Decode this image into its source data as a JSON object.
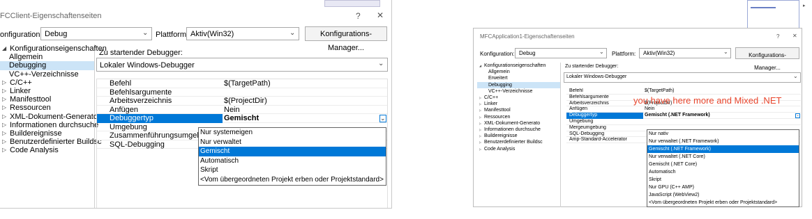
{
  "left": {
    "title": "FCClient-Eigenschaftenseiten",
    "help_glyph": "?",
    "close_glyph": "✕",
    "config_label": "onfiguration:",
    "config_value": "Debug",
    "platform_label": "Plattform:",
    "platform_value": "Aktiv(Win32)",
    "config_manager": "Konfigurations-Manager...",
    "tree": [
      {
        "label": "Konfigurationseigenschaften",
        "exp": "◢",
        "level": 0
      },
      {
        "label": "Allgemein",
        "exp": "",
        "level": 1
      },
      {
        "label": "Debugging",
        "exp": "",
        "level": 1,
        "selected": true
      },
      {
        "label": "VC++-Verzeichnisse",
        "exp": "",
        "level": 1
      },
      {
        "label": "C/C++",
        "exp": "▷",
        "level": 0
      },
      {
        "label": "Linker",
        "exp": "▷",
        "level": 0
      },
      {
        "label": "Manifesttool",
        "exp": "▷",
        "level": 0
      },
      {
        "label": "Ressourcen",
        "exp": "▷",
        "level": 0
      },
      {
        "label": "XML-Dokument-Generato",
        "exp": "▷",
        "level": 0
      },
      {
        "label": "Informationen durchsuche",
        "exp": "▷",
        "level": 0
      },
      {
        "label": "Buildereignisse",
        "exp": "▷",
        "level": 0
      },
      {
        "label": "Benutzerdefinierter Buildsc",
        "exp": "▷",
        "level": 0
      },
      {
        "label": "Code Analysis",
        "exp": "▷",
        "level": 0
      }
    ],
    "debugger_label": "Zu startender Debugger:",
    "debugger_value": "Lokaler Windows-Debugger",
    "props": [
      {
        "name": "Befehl",
        "value": "$(TargetPath)"
      },
      {
        "name": "Befehlsargumente",
        "value": ""
      },
      {
        "name": "Arbeitsverzeichnis",
        "value": "$(ProjectDir)"
      },
      {
        "name": "Anfügen",
        "value": "Nein"
      },
      {
        "name": "Debuggertyp",
        "value": "Gemischt",
        "selected": true
      },
      {
        "name": "Umgebung",
        "value": ""
      },
      {
        "name": "Zusammenführungsumgebung",
        "value": ""
      },
      {
        "name": "SQL-Debugging",
        "value": ""
      }
    ],
    "options": [
      {
        "label": "Nur systemeigen"
      },
      {
        "label": "Nur verwaltet"
      },
      {
        "label": "Gemischt",
        "selected": true
      },
      {
        "label": "Automatisch"
      },
      {
        "label": "Skript"
      },
      {
        "label": "<Vom übergeordneten Projekt erben oder Projektstandard>"
      }
    ]
  },
  "right": {
    "title": "MFCApplication1-Eigenschaftenseiten",
    "help_glyph": "?",
    "close_glyph": "✕",
    "config_label": "Konfiguration:",
    "config_value": "Debug",
    "platform_label": "Plattform:",
    "platform_value": "Aktiv(Win32)",
    "config_manager": "Konfigurations-Manager...",
    "tree": [
      {
        "label": "Konfigurationseigenschaften",
        "exp": "◢",
        "level": 0
      },
      {
        "label": "Allgemein",
        "exp": "",
        "level": 1
      },
      {
        "label": "Erweitert",
        "exp": "",
        "level": 1
      },
      {
        "label": "Debugging",
        "exp": "",
        "level": 1,
        "selected": true
      },
      {
        "label": "VC++-Verzeichnisse",
        "exp": "",
        "level": 1
      },
      {
        "label": "C/C++",
        "exp": "▷",
        "level": 0
      },
      {
        "label": "Linker",
        "exp": "▷",
        "level": 0
      },
      {
        "label": "Manifesttool",
        "exp": "▷",
        "level": 0
      },
      {
        "label": "Ressourcen",
        "exp": "▷",
        "level": 0
      },
      {
        "label": "XML-Dokument-Generato",
        "exp": "▷",
        "level": 0
      },
      {
        "label": "Informationen durchsuche",
        "exp": "▷",
        "level": 0
      },
      {
        "label": "Buildereignisse",
        "exp": "▷",
        "level": 0
      },
      {
        "label": "Benutzerdefinierter Buildsc",
        "exp": "▷",
        "level": 0
      },
      {
        "label": "Code Analysis",
        "exp": "▷",
        "level": 0
      }
    ],
    "debugger_label": "Zu startender Debugger:",
    "debugger_value": "Lokaler Windows-Debugger",
    "props": [
      {
        "name": "Befehl",
        "value": "$(TargetPath)"
      },
      {
        "name": "Befehlsargumente",
        "value": ""
      },
      {
        "name": "Arbeitsverzeichnis",
        "value": "$(ProjectDir)"
      },
      {
        "name": "Anfügen",
        "value": "Nein"
      },
      {
        "name": "Debuggertyp",
        "value": "Gemischt (.NET Framework)",
        "selected": true
      },
      {
        "name": "Umgebung",
        "value": ""
      },
      {
        "name": "Mergeumgebung",
        "value": ""
      },
      {
        "name": "SQL-Debugging",
        "value": ""
      },
      {
        "name": "Amp-Standard-Accelerator",
        "value": ""
      }
    ],
    "options": [
      {
        "label": "Nur nativ"
      },
      {
        "label": "Nur verwaltet (.NET Framework)"
      },
      {
        "label": "Gemischt (.NET Framework)",
        "selected": true
      },
      {
        "label": "Nur verwaltet (.NET Core)"
      },
      {
        "label": "Gemischt (.NET Core)"
      },
      {
        "label": "Automatisch"
      },
      {
        "label": "Skript"
      },
      {
        "label": "Nur GPU (C++ AMP)"
      },
      {
        "label": "JavaScript (WebView2)"
      },
      {
        "label": "<Vom übergeordneten Projekt erben oder Projektstandard>"
      }
    ],
    "annotation": "you have here more and Mixed  .NET",
    "annotation_color": "#e8452c"
  },
  "colors": {
    "selection": "#0078d7",
    "tree_selection": "#cce4f7"
  }
}
